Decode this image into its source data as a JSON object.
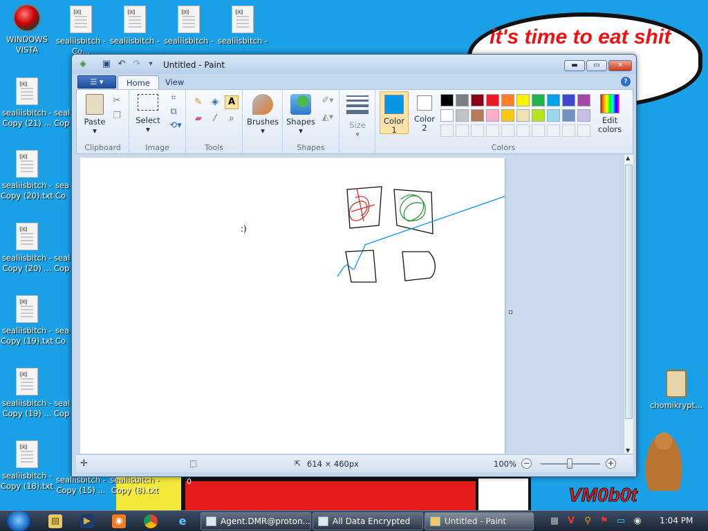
{
  "desktop": {
    "bubble_text": "it's time to eat shit\n ew",
    "watermark": "VM0b0t",
    "zero_label": "0",
    "icons": [
      {
        "label": "WINDOWS VISTA"
      },
      {
        "label": "sealiisbitch - Co..."
      },
      {
        "label": "sealiisbitch -"
      },
      {
        "label": "sealiisbitch -"
      },
      {
        "label": "sealiisbitch -"
      },
      {
        "label": "sealiisbitch - Copy (21) ..."
      },
      {
        "label": "seal Cop"
      },
      {
        "label": "sealiisbitch - Copy (20).txt"
      },
      {
        "label": "sea Co"
      },
      {
        "label": "sealiisbitch - Copy (20) ..."
      },
      {
        "label": "seal Cop"
      },
      {
        "label": "sealiisbitch - Copy (19).txt"
      },
      {
        "label": "sea Co"
      },
      {
        "label": "sealiisbitch - Copy (19) ..."
      },
      {
        "label": "seal Cop"
      },
      {
        "label": "sealiisbitch - Copy (18).txt"
      },
      {
        "label": "sealiisbitch - Copy (15) ..."
      },
      {
        "label": "sealiisbitch - Copy (8).txt"
      },
      {
        "label": "chomikrypt..."
      }
    ]
  },
  "paint": {
    "title": "Untitled - Paint",
    "window_buttons": {
      "minimize": "▬",
      "maximize": "▭",
      "close": "✕"
    },
    "tabs": [
      "Home",
      "View"
    ],
    "groups": {
      "clipboard": "Clipboard",
      "image": "Image",
      "tools": "Tools",
      "shapes": "Shapes",
      "colors": "Colors"
    },
    "buttons": {
      "paste": "Paste",
      "select": "Select",
      "brushes": "Brushes",
      "shapes": "Shapes",
      "size": "Size",
      "color1": "Color\n1",
      "color2": "Color\n2",
      "edit_colors": "Edit\ncolors"
    },
    "color1": "#0a96e6",
    "color2": "#ffffff",
    "palette_row1": [
      "#000000",
      "#7f7f7f",
      "#880015",
      "#ed1c24",
      "#ff7f27",
      "#fff200",
      "#22b14c",
      "#00a2e8",
      "#3f48cc",
      "#a349a4"
    ],
    "palette_row2": [
      "#ffffff",
      "#c3c3c3",
      "#b97a57",
      "#ffaec9",
      "#ffc90e",
      "#efe4b0",
      "#b5e61d",
      "#99d9ea",
      "#7092be",
      "#c8bfe7"
    ],
    "canvas_text": ":)",
    "status": {
      "dimensions": "614 × 460px",
      "zoom": "100%"
    }
  },
  "taskbar": {
    "buttons": [
      {
        "label": "Agent.DMR@proton..."
      },
      {
        "label": "All Data Encrypted"
      },
      {
        "label": "Untitled - Paint"
      }
    ],
    "clock": "1:04 PM"
  }
}
